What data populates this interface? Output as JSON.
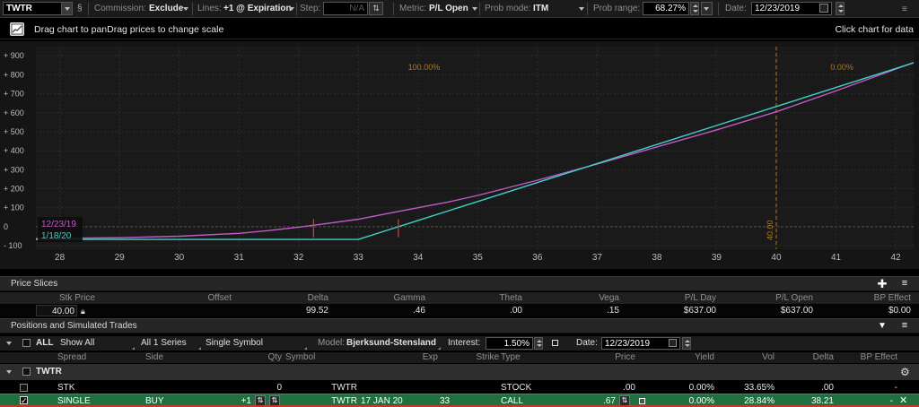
{
  "toolbar": {
    "symbol": "TWTR",
    "commission_label": "Commission:",
    "commission_value": "Exclude",
    "lines_label": "Lines:",
    "lines_value": "+1 @ Expiration",
    "step_label": "Step:",
    "step_value": "N/A",
    "metric_label": "Metric:",
    "metric_value": "P/L Open",
    "prob_mode_label": "Prob mode:",
    "prob_mode_value": "ITM",
    "prob_range_label": "Prob range:",
    "prob_range_value": "68.27%",
    "date_label": "Date:",
    "date_value": "12/23/2019"
  },
  "infobar": {
    "drag_text": "Drag chart to panDrag prices to change scale",
    "click_text": "Click chart for data"
  },
  "chart_data": {
    "type": "line",
    "xlim": [
      27.6,
      42.3
    ],
    "ylim": [
      -90,
      920
    ],
    "x_ticks": [
      "28",
      "29",
      "30",
      "31",
      "32",
      "33",
      "34",
      "35",
      "36",
      "37",
      "38",
      "39",
      "40",
      "41",
      "42"
    ],
    "y_ticks": [
      "+ 900",
      "+ 800",
      "+ 700",
      "+ 600",
      "+ 500",
      "+ 400",
      "+ 300",
      "+ 200",
      "+ 100",
      "0",
      "- 100"
    ],
    "grid": true,
    "legend": "bottom-left",
    "series": [
      {
        "name": "12/23/19",
        "color": "#c45ac9",
        "x": [
          27.6,
          29,
          30,
          31,
          31.5,
          32,
          32.5,
          33,
          33.5,
          34,
          34.5,
          35,
          36,
          37,
          38,
          39,
          40,
          41,
          42,
          42.3
        ],
        "y": [
          -62,
          -58,
          -50,
          -35,
          -20,
          -2,
          18,
          40,
          70,
          100,
          130,
          165,
          245,
          330,
          420,
          510,
          605,
          715,
          830,
          865
        ]
      },
      {
        "name": "1/18/20",
        "color": "#3fd1c8",
        "x": [
          27.6,
          32,
          33,
          34,
          35,
          36,
          37,
          38,
          39,
          40,
          41,
          42,
          42.3
        ],
        "y": [
          -67,
          -67,
          -67,
          33,
          133,
          233,
          333,
          433,
          533,
          633,
          733,
          833,
          863
        ]
      }
    ],
    "markers": [
      {
        "x": 32.25,
        "color": "#e03030"
      },
      {
        "x": 33.67,
        "color": "#e03030"
      }
    ],
    "vline": {
      "x": 40,
      "label": "40.00",
      "color": "#b07a1c"
    },
    "annotations": [
      {
        "text": "100.00%",
        "x": 34.1,
        "color": "#b07a1c"
      },
      {
        "text": "0.00%",
        "x": 41.1,
        "color": "#b07a1c"
      }
    ]
  },
  "price_slices": {
    "title": "Price Slices",
    "columns": [
      "Stk Price",
      "Offset",
      "Delta",
      "Gamma",
      "Theta",
      "Vega",
      "P/L Day",
      "P/L Open",
      "BP Effect"
    ],
    "row": [
      "40.00",
      "",
      "99.52",
      ".46",
      ".00",
      ".15",
      "$637.00",
      "$637.00",
      "$0.00"
    ]
  },
  "positions": {
    "title": "Positions and Simulated Trades",
    "all_label": "ALL",
    "show_label": "Show All",
    "series_label": "All 1 Series",
    "symbol_mode": "Single Symbol",
    "model_label": "Model:",
    "model_value": "Bjerksund-Stensland",
    "interest_label": "Interest:",
    "interest_value": "1.50%",
    "date_label": "Date:",
    "date_value": "12/23/2019",
    "columns": [
      "Spread",
      "Side",
      "Qty",
      "Symbol",
      "Exp",
      "Strike",
      "Type",
      "Price",
      "Yield",
      "Vol",
      "Delta",
      "BP Effect"
    ],
    "group": "TWTR",
    "rows": [
      {
        "spread": "STK",
        "side": "",
        "qty": "0",
        "symbol": "TWTR",
        "exp": "",
        "strike": "",
        "type": "STOCK",
        "price": ".00",
        "yield": "0.00%",
        "vol": "33.65%",
        "delta": ".00",
        "bp": "-"
      },
      {
        "spread": "SINGLE",
        "side": "BUY",
        "qty": "+1",
        "symbol": "TWTR",
        "exp": "17 JAN 20",
        "strike": "33",
        "type": "CALL",
        "price": ".67",
        "yield": "0.00%",
        "vol": "28.84%",
        "delta": "38.21",
        "bp": "-"
      }
    ]
  }
}
